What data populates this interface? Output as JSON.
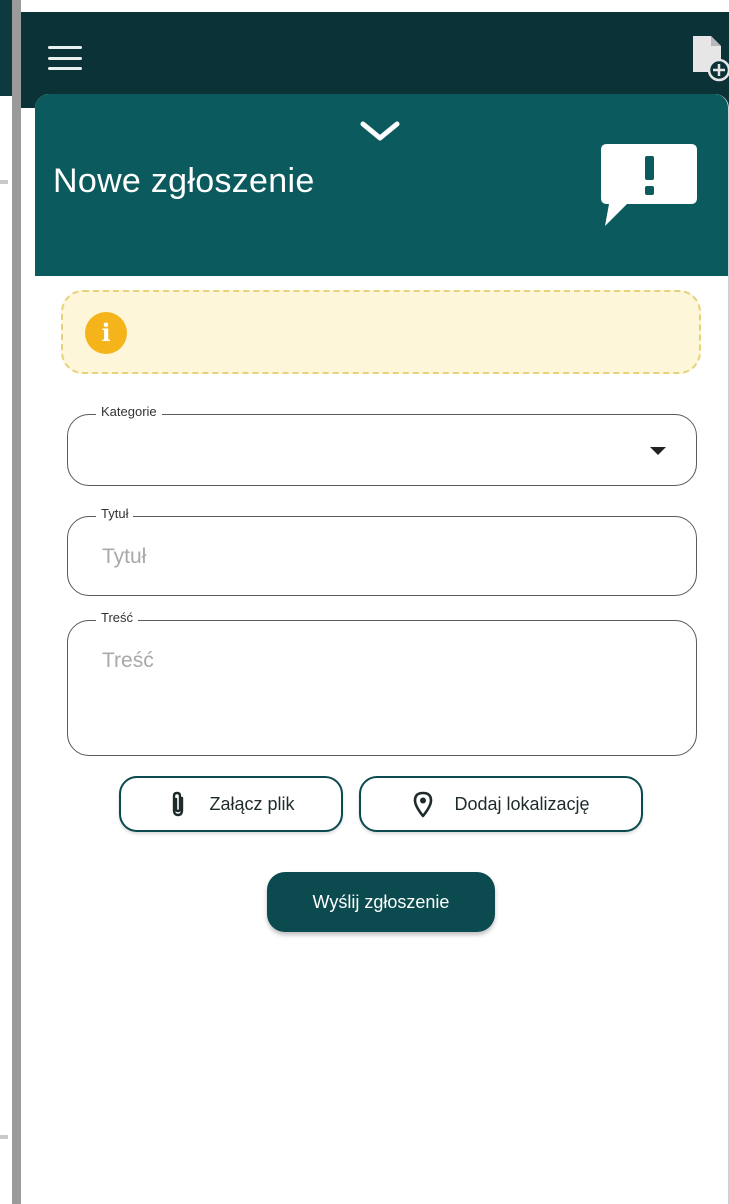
{
  "sheet": {
    "title": "Nowe zgłoszenie"
  },
  "form": {
    "category": {
      "label": "Kategorie",
      "value": ""
    },
    "title": {
      "label": "Tytuł",
      "placeholder": "Tytuł"
    },
    "content": {
      "label": "Treść",
      "placeholder": "Treść"
    }
  },
  "actions": {
    "attach_label": "Załącz plik",
    "location_label": "Dodaj lokalizację",
    "submit_label": "Wyślij zgłoszenie"
  },
  "icons": {
    "menu": "hamburger-menu-icon",
    "new_document": "new-document-plus-icon",
    "collapse": "chevron-down-icon",
    "report": "alert-speech-bubble-icon",
    "info": "info-circle-icon",
    "attach": "paperclip-icon",
    "location": "location-pin-icon",
    "dropdown": "caret-down-icon"
  },
  "colors": {
    "app_bar": "#0b3236",
    "sheet_header": "#0b5a5e",
    "primary": "#0b4a4e",
    "info_bg": "#fdf6d8",
    "info_border": "#e6d27a",
    "info_icon": "#f4b41a"
  }
}
